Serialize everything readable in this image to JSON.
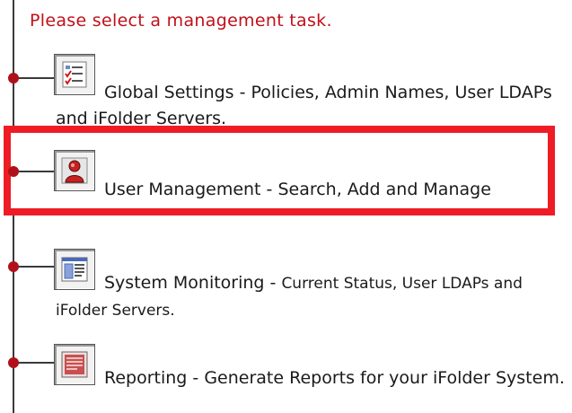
{
  "prompt": "Please select a management task.",
  "tasks": [
    {
      "id": "global-settings",
      "name": "Global Settings",
      "separator": " - ",
      "description": "Policies, Admin Names, User LDAPs and iFolder Servers.",
      "icon": "checklist-icon"
    },
    {
      "id": "user-management",
      "name": "User Management",
      "separator": " - ",
      "description": "Search, Add and Manage",
      "icon": "user-icon",
      "highlighted": true,
      "highlight_color": "#ee1c25"
    },
    {
      "id": "system-monitoring",
      "name": "System Monitoring",
      "separator": " - ",
      "description": "Current Status, User LDAPs and iFolder Servers.",
      "icon": "monitor-window-icon"
    },
    {
      "id": "reporting",
      "name": "Reporting",
      "separator": " - ",
      "description": "Generate Reports for your iFolder System.",
      "icon": "report-icon"
    }
  ],
  "colors": {
    "prompt": "#c0101a",
    "node": "#b0101a",
    "tree_line": "#3a3a3a",
    "highlight": "#ee1c25"
  }
}
